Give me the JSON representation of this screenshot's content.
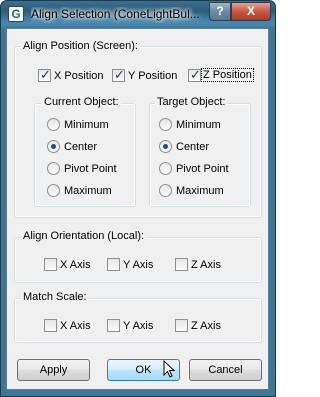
{
  "window": {
    "title": "Align Selection (ConeLightBul...",
    "app_icon_letter": "G",
    "help_label": "?",
    "close_label": "X"
  },
  "align_position": {
    "label": "Align Position (Screen):",
    "x_position": {
      "label": "X Position",
      "checked": true
    },
    "y_position": {
      "label": "Y Position",
      "checked": true
    },
    "z_position": {
      "label": "Z Position",
      "checked": true
    },
    "current_object": {
      "label": "Current Object:",
      "options": [
        "Minimum",
        "Center",
        "Pivot Point",
        "Maximum"
      ],
      "selected": "Center"
    },
    "target_object": {
      "label": "Target Object:",
      "options": [
        "Minimum",
        "Center",
        "Pivot Point",
        "Maximum"
      ],
      "selected": "Center"
    }
  },
  "align_orientation": {
    "label": "Align Orientation (Local):",
    "x_axis": {
      "label": "X Axis",
      "checked": false
    },
    "y_axis": {
      "label": "Y Axis",
      "checked": false
    },
    "z_axis": {
      "label": "Z Axis",
      "checked": false
    }
  },
  "match_scale": {
    "label": "Match Scale:",
    "x_axis": {
      "label": "X Axis",
      "checked": false
    },
    "y_axis": {
      "label": "Y Axis",
      "checked": false
    },
    "z_axis": {
      "label": "Z Axis",
      "checked": false
    }
  },
  "buttons": {
    "apply": "Apply",
    "ok": "OK",
    "cancel": "Cancel"
  },
  "icons": {
    "checkmark": "✓",
    "cursor": "arrow-cursor-icon"
  }
}
